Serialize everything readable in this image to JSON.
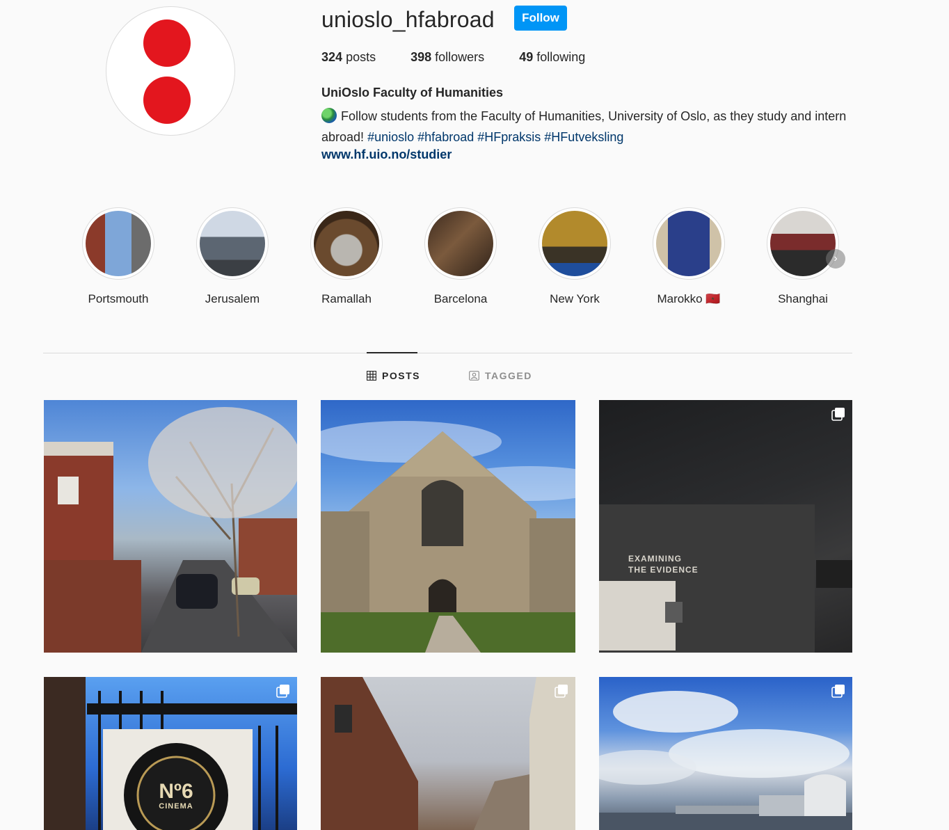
{
  "profile": {
    "username": "unioslo_hfabroad",
    "follow_label": "Follow",
    "stats": {
      "posts_count": "324",
      "posts_label": "posts",
      "followers_count": "398",
      "followers_label": "followers",
      "following_count": "49",
      "following_label": "following"
    },
    "full_name": "UniOslo Faculty of Humanities",
    "bio_text": "Follow students from the Faculty of Humanities, University of Oslo, as they study and intern abroad!",
    "hashtags": [
      "#unioslo",
      "#hfabroad",
      "#HFpraksis",
      "#HFutveksling"
    ],
    "website": "www.hf.uio.no/studier"
  },
  "highlights": [
    {
      "label": "Portsmouth"
    },
    {
      "label": "Jerusalem"
    },
    {
      "label": "Ramallah"
    },
    {
      "label": "Barcelona"
    },
    {
      "label": "New York"
    },
    {
      "label": "Marokko 🇲🇦"
    },
    {
      "label": "Shanghai"
    }
  ],
  "tabs": {
    "posts": "POSTS",
    "tagged": "TAGGED"
  },
  "posts": {
    "p3_sign_line1": "EXAMINING",
    "p3_sign_line2": "THE EVIDENCE",
    "p4_sign_number": "Nº6",
    "p4_sign_word": "CINEMA"
  },
  "colors": {
    "follow_button": "#0095f6",
    "link": "#00376b",
    "avatar_dots": "#e3161e"
  }
}
